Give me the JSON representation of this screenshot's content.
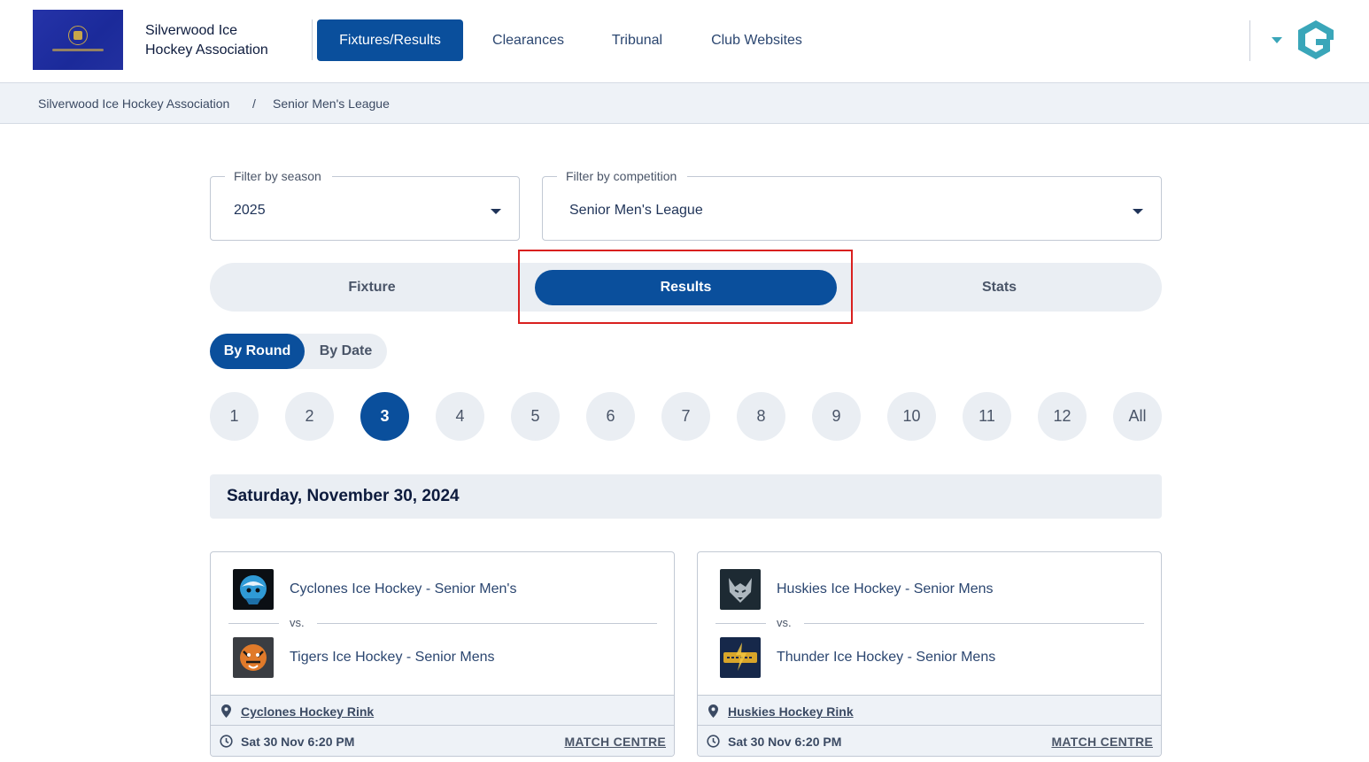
{
  "header": {
    "org_name_line1": "Silverwood Ice",
    "org_name_line2": "Hockey Association",
    "nav": [
      {
        "label": "Fixtures/Results",
        "active": true
      },
      {
        "label": "Clearances"
      },
      {
        "label": "Tribunal"
      },
      {
        "label": "Club Websites"
      }
    ],
    "brand_accent": "#3aa6b9",
    "primary_color": "#0a4f9c"
  },
  "breadcrumb": {
    "items": [
      "Silverwood Ice Hockey Association",
      "Senior Men's League"
    ],
    "separator": "/"
  },
  "filters": {
    "season": {
      "label": "Filter by season",
      "value": "2025"
    },
    "competition": {
      "label": "Filter by competition",
      "value": "Senior Men's League"
    }
  },
  "tabs": [
    {
      "label": "Fixture"
    },
    {
      "label": "Results",
      "active": true
    },
    {
      "label": "Stats"
    }
  ],
  "view_toggle": [
    {
      "label": "By Round",
      "active": true
    },
    {
      "label": "By Date"
    }
  ],
  "rounds": [
    "1",
    "2",
    "3",
    "4",
    "5",
    "6",
    "7",
    "8",
    "9",
    "10",
    "11",
    "12",
    "All"
  ],
  "active_round": "3",
  "date_heading": "Saturday, November 30, 2024",
  "matches": [
    {
      "home": "Cyclones Ice Hockey - Senior Men's",
      "vs": "vs.",
      "away": "Tigers Ice Hockey - Senior Mens",
      "venue": "Cyclones Hockey Rink",
      "time": "Sat 30 Nov 6:20 PM",
      "match_centre": "MATCH CENTRE"
    },
    {
      "home": "Huskies Ice Hockey - Senior Mens",
      "vs": "vs.",
      "away": "Thunder Ice Hockey - Senior Mens",
      "venue": "Huskies Hockey Rink",
      "time": "Sat 30 Nov 6:20 PM",
      "match_centre": "MATCH CENTRE"
    }
  ]
}
